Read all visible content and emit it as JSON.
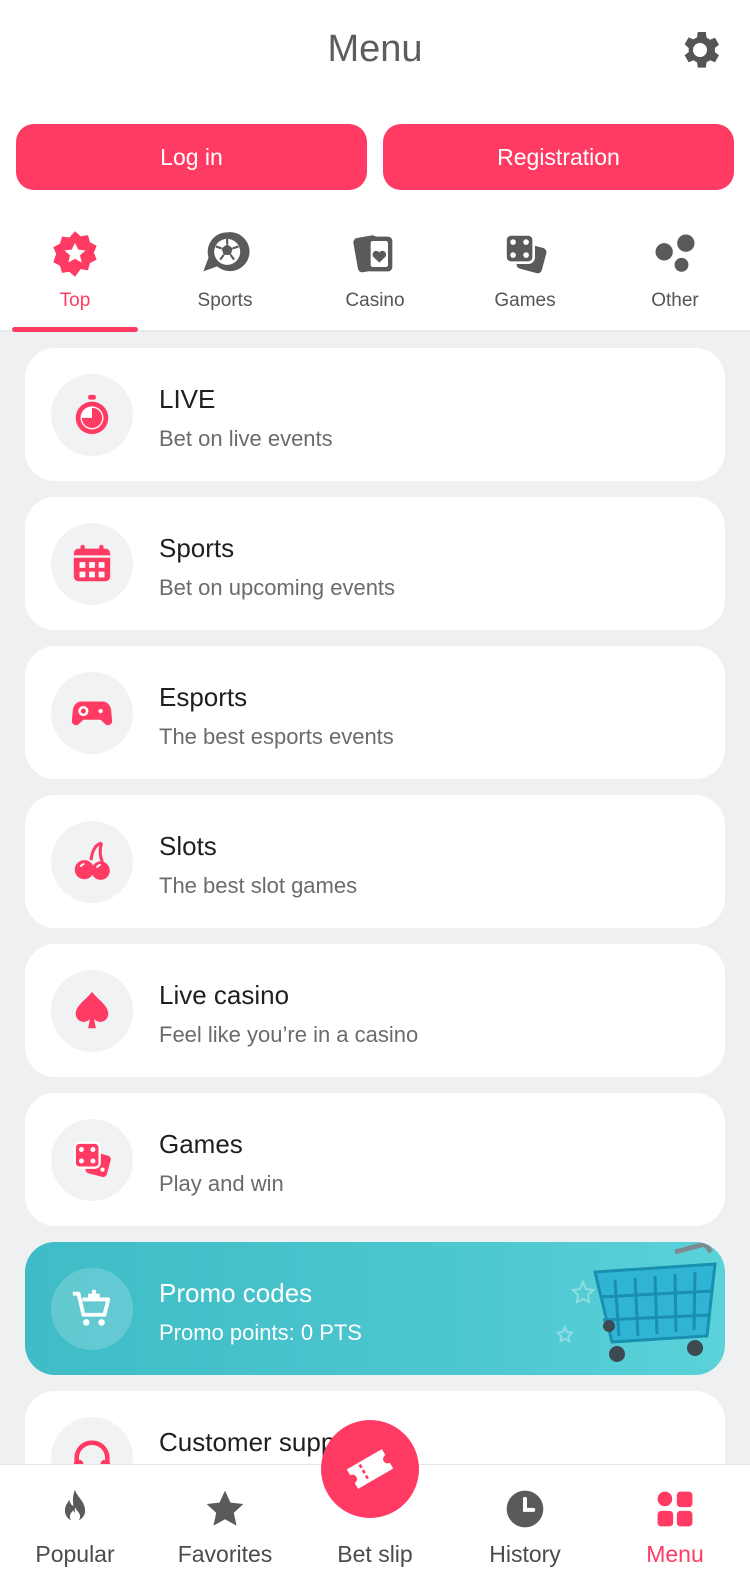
{
  "header": {
    "title": "Menu",
    "settings_icon": "gear-icon"
  },
  "auth": {
    "login_label": "Log in",
    "register_label": "Registration"
  },
  "colors": {
    "accent": "#ff3b63",
    "promo": "#4cc6cf",
    "background": "#eef0f2"
  },
  "tabs": [
    {
      "label": "Top",
      "icon": "star-badge-icon",
      "active": true
    },
    {
      "label": "Sports",
      "icon": "soccer-ball-icon",
      "active": false
    },
    {
      "label": "Casino",
      "icon": "playing-cards-icon",
      "active": false
    },
    {
      "label": "Games",
      "icon": "dice-icon",
      "active": false
    },
    {
      "label": "Other",
      "icon": "dots-icon",
      "active": false
    }
  ],
  "items": [
    {
      "title": "LIVE",
      "subtitle": "Bet on live events",
      "icon": "stopwatch-icon"
    },
    {
      "title": "Sports",
      "subtitle": "Bet on upcoming events",
      "icon": "calendar-icon"
    },
    {
      "title": "Esports",
      "subtitle": "The best esports events",
      "icon": "gamepad-icon"
    },
    {
      "title": "Slots",
      "subtitle": "The best slot games",
      "icon": "cherries-icon"
    },
    {
      "title": "Live casino",
      "subtitle": "Feel like you’re in a casino",
      "icon": "spade-icon"
    },
    {
      "title": "Games",
      "subtitle": "Play and win",
      "icon": "dice-icon"
    },
    {
      "title": "Promo codes",
      "subtitle": "Promo points: 0 PTS",
      "icon": "cart-icon"
    },
    {
      "title": "Customer support",
      "subtitle": "",
      "icon": "headset-icon"
    }
  ],
  "bottom_nav": [
    {
      "label": "Popular",
      "icon": "flame-icon",
      "active": false
    },
    {
      "label": "Favorites",
      "icon": "star-icon",
      "active": false
    },
    {
      "label": "Bet slip",
      "icon": "ticket-icon",
      "active": false
    },
    {
      "label": "History",
      "icon": "clock-icon",
      "active": false
    },
    {
      "label": "Menu",
      "icon": "grid-icon",
      "active": true
    }
  ]
}
